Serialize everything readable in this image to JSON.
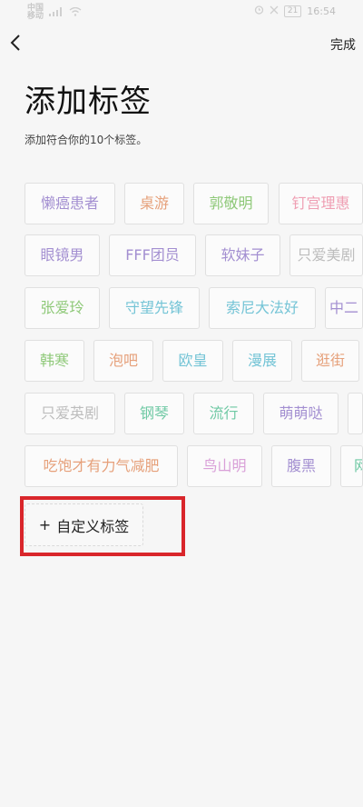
{
  "status_bar": {
    "carrier": "中国\n移动",
    "battery": "21",
    "time": "16:54"
  },
  "nav": {
    "done_label": "完成"
  },
  "title": "添加标签",
  "subtitle": "添加符合你的10个标签。",
  "custom_tag": {
    "plus": "+",
    "label": "自定义标签"
  },
  "tags": [
    {
      "label": "懒癌患者",
      "color": "#a38fd1"
    },
    {
      "label": "桌游",
      "color": "#e6a07a"
    },
    {
      "label": "郭敬明",
      "color": "#8fc979"
    },
    {
      "label": "钉宫理惠",
      "color": "#ef9fb3"
    },
    {
      "label": "眼镜男",
      "color": "#a38fd1"
    },
    {
      "label": "FFF团员",
      "color": "#a38fd1"
    },
    {
      "label": "软妹子",
      "color": "#a38fd1"
    },
    {
      "label": "只爱美剧",
      "color": "#bdbdbd"
    },
    {
      "label": "张爱玲",
      "color": "#8fc979"
    },
    {
      "label": "守望先锋",
      "color": "#74c4d6"
    },
    {
      "label": "索尼大法好",
      "color": "#74c4d6"
    },
    {
      "label": "中二",
      "color": "#a38fd1"
    },
    {
      "label": "韩寒",
      "color": "#8fc979"
    },
    {
      "label": "泡吧",
      "color": "#e6a07a"
    },
    {
      "label": "欧皇",
      "color": "#74c4d6"
    },
    {
      "label": "漫展",
      "color": "#74c4d6"
    },
    {
      "label": "逛街",
      "color": "#e6a07a"
    },
    {
      "label": "只爱英剧",
      "color": "#bdbdbd"
    },
    {
      "label": "钢琴",
      "color": "#6fc9a4"
    },
    {
      "label": "流行",
      "color": "#6fc9a4"
    },
    {
      "label": "萌萌哒",
      "color": "#a38fd1"
    },
    {
      "label": "",
      "color": "#a38fd1"
    },
    {
      "label": "吃饱才有力气减肥",
      "color": "#e6a07a"
    },
    {
      "label": "鸟山明",
      "color": "#d9a0d8"
    },
    {
      "label": "腹黑",
      "color": "#a38fd1"
    },
    {
      "label": "网",
      "color": "#6fc9a4"
    }
  ],
  "highlight_color": "#d9262b"
}
